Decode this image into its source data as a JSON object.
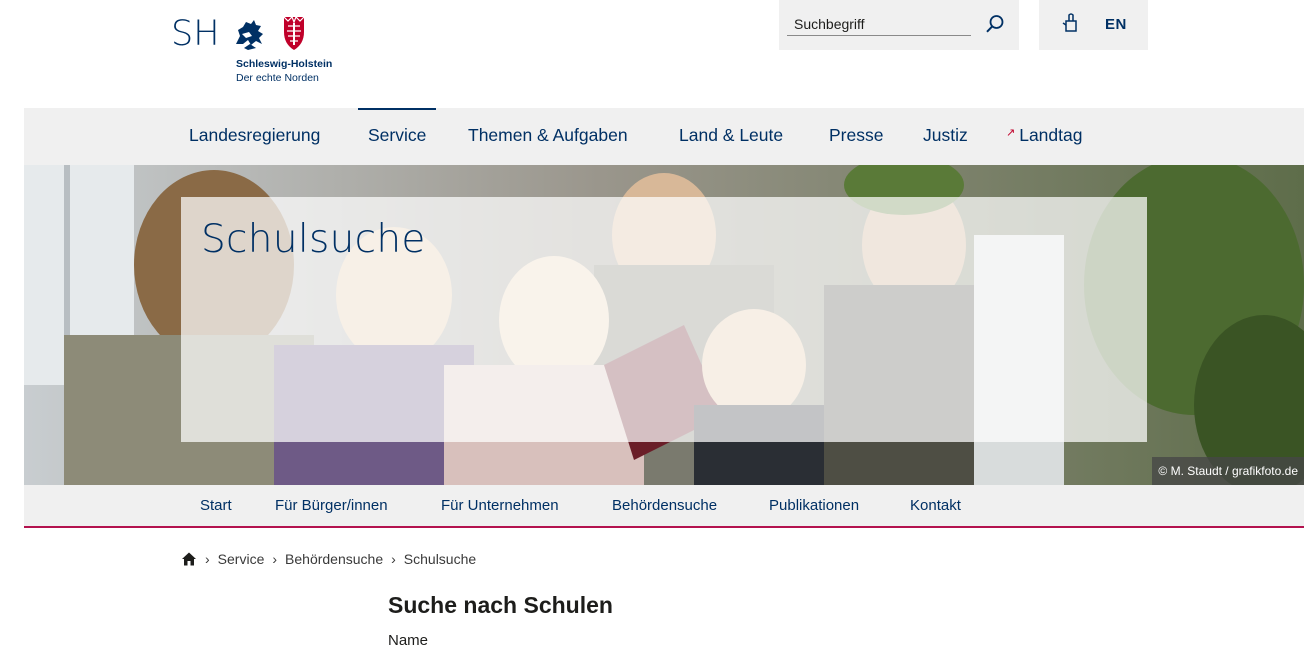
{
  "header": {
    "logo": {
      "letters": "SH",
      "state_name": "Schleswig-Holstein",
      "tagline": "Der echte Norden"
    },
    "search": {
      "placeholder": "Suchbegriff",
      "icon": "search-icon"
    },
    "language": {
      "icon": "sign-language-icon",
      "label": "EN"
    }
  },
  "main_nav": {
    "items": [
      {
        "label": "Landesregierung"
      },
      {
        "label": "Service",
        "active": true
      },
      {
        "label": "Themen & Aufgaben"
      },
      {
        "label": "Land & Leute"
      },
      {
        "label": "Presse"
      },
      {
        "label": "Justiz"
      },
      {
        "label": "Landtag",
        "external": true
      }
    ]
  },
  "hero": {
    "title": "Schulsuche",
    "photo_credit": "© M. Staudt / grafikfoto.de"
  },
  "sub_nav": {
    "items": [
      {
        "label": "Start"
      },
      {
        "label": "Für Bürger/innen"
      },
      {
        "label": "Für Unternehmen"
      },
      {
        "label": "Behördensuche"
      },
      {
        "label": "Publikationen"
      },
      {
        "label": "Kontakt"
      }
    ]
  },
  "breadcrumb": {
    "home_icon": "home-icon",
    "items": [
      "Service",
      "Behördensuche",
      "Schulsuche"
    ]
  },
  "content": {
    "title": "Suche nach Schulen",
    "field_label": "Name"
  },
  "colors": {
    "brand_blue": "#003064",
    "accent_red": "#b3124e",
    "nav_background": "#f0f0f0"
  }
}
